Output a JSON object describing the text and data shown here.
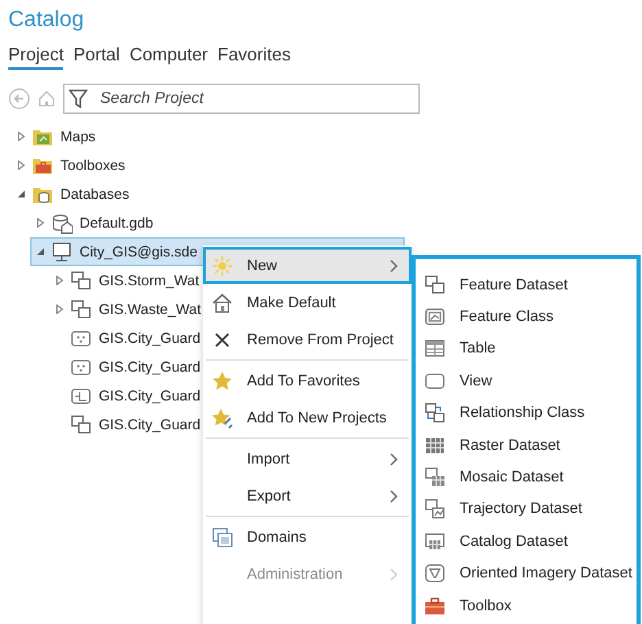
{
  "panel": {
    "title": "Catalog"
  },
  "tabs": [
    {
      "label": "Project",
      "selected": true
    },
    {
      "label": "Portal",
      "selected": false
    },
    {
      "label": "Computer",
      "selected": false
    },
    {
      "label": "Favorites",
      "selected": false
    }
  ],
  "search": {
    "placeholder": "Search Project"
  },
  "tree": [
    {
      "label": "Maps",
      "kind": "maps-folder",
      "expanded": false,
      "selected": false
    },
    {
      "label": "Toolboxes",
      "kind": "toolbox-folder",
      "expanded": false,
      "selected": false
    },
    {
      "label": "Databases",
      "kind": "database-folder",
      "expanded": true,
      "selected": false,
      "children": [
        {
          "label": "Default.gdb",
          "kind": "gdb",
          "expanded": false,
          "selected": false
        },
        {
          "label": "City_GIS@gis.sde",
          "kind": "sde",
          "expanded": true,
          "selected": true,
          "children": [
            {
              "label": "GIS.Storm_Wat",
              "kind": "feature-dataset",
              "expanded": false,
              "selected": false
            },
            {
              "label": "GIS.Waste_Wat",
              "kind": "feature-dataset",
              "expanded": false,
              "selected": false
            },
            {
              "label": "GIS.City_Guard",
              "kind": "point-class",
              "selected": false
            },
            {
              "label": "GIS.City_Guard",
              "kind": "point-class",
              "selected": false
            },
            {
              "label": "GIS.City_Guard",
              "kind": "line-class",
              "selected": false
            },
            {
              "label": "GIS.City_Guard",
              "kind": "feature-dataset",
              "selected": false
            }
          ]
        }
      ]
    }
  ],
  "context_menu": {
    "groups": [
      [
        {
          "label": "New",
          "kind": "sun",
          "submenu": true,
          "highlighted": true,
          "disabled": false
        },
        {
          "label": "Make Default",
          "kind": "house",
          "submenu": false,
          "highlighted": false,
          "disabled": false
        },
        {
          "label": "Remove From Project",
          "kind": "cross",
          "submenu": false,
          "highlighted": false,
          "disabled": false
        }
      ],
      [
        {
          "label": "Add To Favorites",
          "kind": "star",
          "submenu": false,
          "highlighted": false,
          "disabled": false
        },
        {
          "label": "Add To New Projects",
          "kind": "star-plus",
          "submenu": false,
          "highlighted": false,
          "disabled": false
        }
      ],
      [
        {
          "label": "Import",
          "kind": "plain",
          "submenu": true,
          "highlighted": false,
          "disabled": false
        },
        {
          "label": "Export",
          "kind": "plain",
          "submenu": true,
          "highlighted": false,
          "disabled": false
        }
      ],
      [
        {
          "label": "Domains",
          "kind": "domains",
          "submenu": false,
          "highlighted": false,
          "disabled": false
        },
        {
          "label": "Administration",
          "kind": "plain",
          "submenu": true,
          "highlighted": false,
          "disabled": true
        }
      ]
    ]
  },
  "submenu": [
    {
      "label": "Feature Dataset",
      "kind": "feature-dataset"
    },
    {
      "label": "Feature Class",
      "kind": "feature-class"
    },
    {
      "label": "Table",
      "kind": "table"
    },
    {
      "label": "View",
      "kind": "view"
    },
    {
      "label": "Relationship Class",
      "kind": "relationship"
    },
    {
      "label": "Raster Dataset",
      "kind": "raster"
    },
    {
      "label": "Mosaic Dataset",
      "kind": "mosaic"
    },
    {
      "label": "Trajectory Dataset",
      "kind": "trajectory"
    },
    {
      "label": "Catalog Dataset",
      "kind": "catalog"
    },
    {
      "label": "Oriented Imagery Dataset",
      "kind": "imagery"
    },
    {
      "label": "Toolbox",
      "kind": "toolbox"
    }
  ]
}
